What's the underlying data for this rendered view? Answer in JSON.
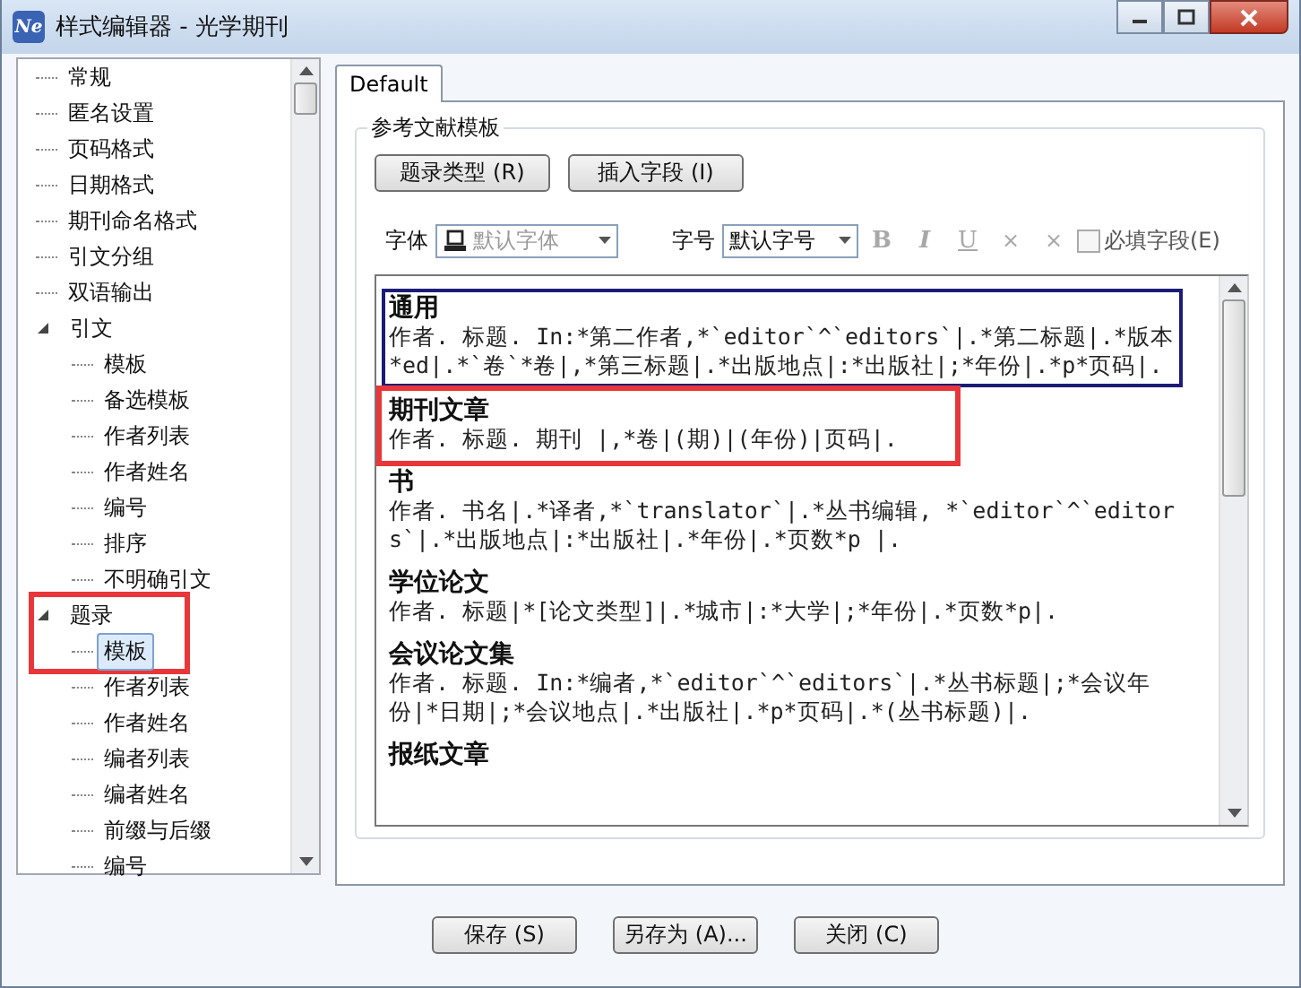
{
  "window": {
    "title": "样式编辑器 - 光学期刊",
    "logo_text": "Ne"
  },
  "tree": [
    {
      "label": "常规",
      "selected": false
    },
    {
      "label": "匿名设置",
      "selected": false
    },
    {
      "label": "页码格式",
      "selected": false
    },
    {
      "label": "日期格式",
      "selected": false
    },
    {
      "label": "期刊命名格式",
      "selected": false
    },
    {
      "label": "引文分组",
      "selected": false
    },
    {
      "label": "双语输出",
      "selected": false
    },
    {
      "label": "引文",
      "selected": false,
      "expanded": true,
      "children": [
        {
          "label": "模板",
          "selected": false
        },
        {
          "label": "备选模板",
          "selected": false
        },
        {
          "label": "作者列表",
          "selected": false
        },
        {
          "label": "作者姓名",
          "selected": false
        },
        {
          "label": "编号",
          "selected": false
        },
        {
          "label": "排序",
          "selected": false
        },
        {
          "label": "不明确引文",
          "selected": false
        }
      ]
    },
    {
      "label": "题录",
      "selected": false,
      "highlighted": true,
      "expanded": true,
      "children": [
        {
          "label": "模板",
          "selected": true
        },
        {
          "label": "作者列表",
          "selected": false
        },
        {
          "label": "作者姓名",
          "selected": false
        },
        {
          "label": "编者列表",
          "selected": false
        },
        {
          "label": "编者姓名",
          "selected": false
        },
        {
          "label": "前缀与后缀",
          "selected": false
        },
        {
          "label": "编号",
          "selected": false
        }
      ]
    }
  ],
  "tabs": [
    {
      "label": "Default",
      "selected": true
    }
  ],
  "group": {
    "title": "参考文献模板",
    "buttons": [
      "题录类型 (R)",
      "插入字段 (I)"
    ],
    "font": {
      "label": "字体",
      "value": "默认字体",
      "disabled": true
    },
    "size": {
      "label": "字号",
      "value": "默认字号",
      "disabled": false
    },
    "format_buttons": [
      {
        "label": "B",
        "kind": "bold",
        "disabled": true
      },
      {
        "label": "I",
        "kind": "italic",
        "disabled": true
      },
      {
        "label": "U",
        "kind": "underline",
        "disabled": true
      },
      {
        "label": "×",
        "kind": "plain",
        "disabled": true
      },
      {
        "label": "×",
        "kind": "plain",
        "disabled": true
      }
    ],
    "required_field": {
      "label": "必填字段(E)",
      "checked": false
    },
    "entries": [
      {
        "title": "通用",
        "body": "作者. 标题. In:*第二作者,*`editor`^`editors`|.*第二标题|.*版本*ed|.*`卷`*卷|,*第三标题|.*出版地点|:*出版社|;*年份|.*p*页码|.",
        "selected": true
      },
      {
        "title": "期刊文章",
        "body": "作者. 标题. 期刊 |,*卷|(期)|(年份)|页码|.",
        "selected": false,
        "highlighted": true
      },
      {
        "title": "书",
        "body": "作者. 书名|.*译者,*`translator`|.*丛书编辑, *`editor`^`editors`|.*出版地点|:*出版社|.*年份|.*页数*p |.",
        "selected": false
      },
      {
        "title": "学位论文",
        "body": "作者. 标题|*[论文类型]|.*城市|:*大学|;*年份|.*页数*p|.",
        "selected": false
      },
      {
        "title": "会议论文集",
        "body": "作者. 标题. In:*编者,*`editor`^`editors`|.*丛书标题|;*会议年份|*日期|;*会议地点|.*出版社|.*p*页码|.*(丛书标题)|.",
        "selected": false
      },
      {
        "title": "报纸文章",
        "selected": false
      }
    ]
  },
  "footer_buttons": [
    "保存 (S)",
    "另存为 (A)...",
    "关闭 (C)"
  ]
}
